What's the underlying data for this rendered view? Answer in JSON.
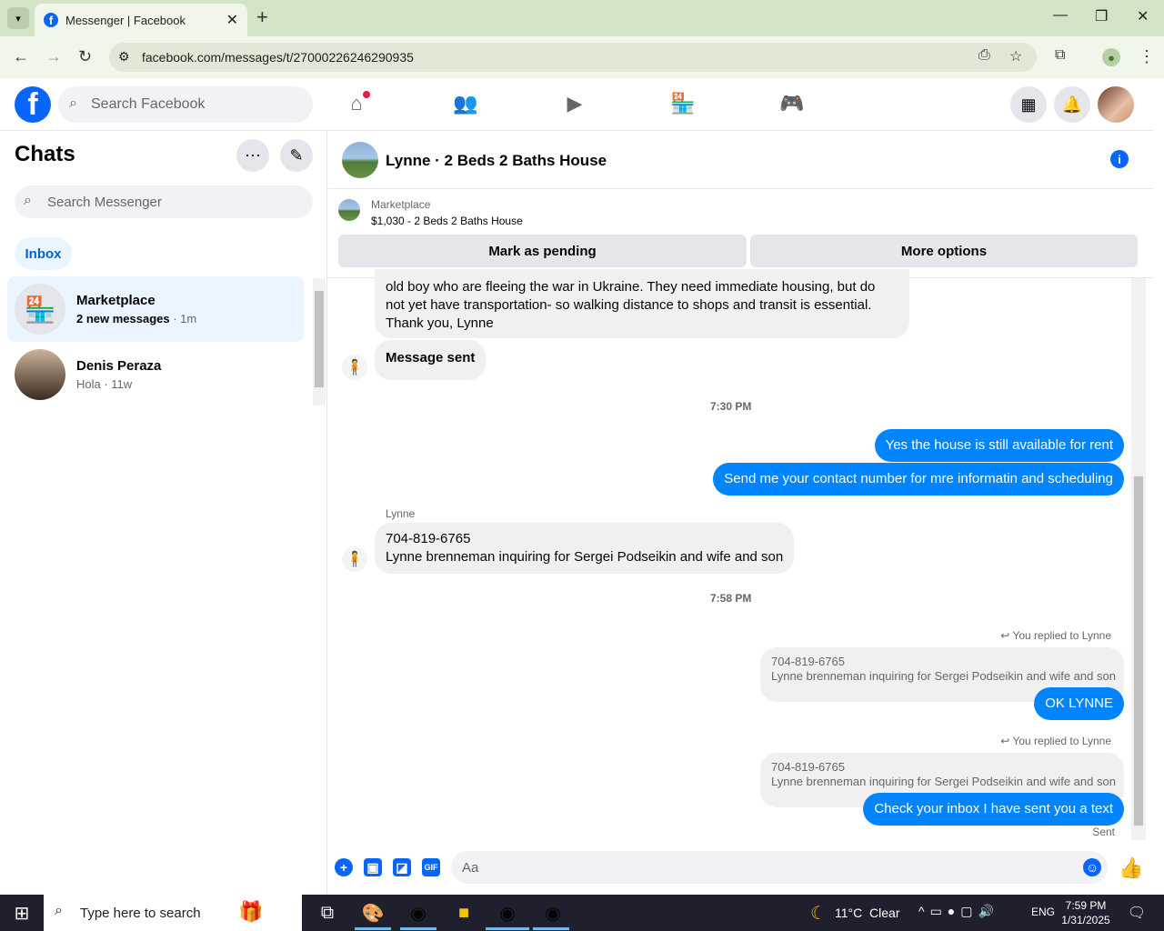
{
  "browser": {
    "tab_title": "Messenger | Facebook",
    "url": "facebook.com/messages/t/27000226246290935"
  },
  "fb": {
    "search_placeholder": "Search Facebook"
  },
  "sidebar": {
    "title": "Chats",
    "search_placeholder": "Search Messenger",
    "filter": "Inbox",
    "chats": [
      {
        "name": "Marketplace",
        "preview_bold": "2 new messages",
        "preview_time": " · 1m"
      },
      {
        "name": "Denis Peraza",
        "preview": "Hola · 11w"
      }
    ]
  },
  "chat": {
    "title": "Lynne · 2 Beds 2 Baths House",
    "marketplace_label": "Marketplace",
    "listing": "$1,030 - 2 Beds 2 Baths House",
    "mark_pending": "Mark as pending",
    "more_options": "More options"
  },
  "messages": {
    "m1_line1": "old boy who are fleeing the war in Ukraine. They need immediate housing, but do",
    "m1_line2": "not yet have transportation- so walking distance to shops and transit is essential.",
    "m1_line3": "Thank you, Lynne",
    "m2": "Message sent",
    "ts1": "7:30 PM",
    "out1": "Yes the house is still available for rent",
    "out2": "Send me your contact number for mre informatin and  scheduling",
    "sender": "Lynne",
    "in3_line1": "704-819-6765",
    "in3_line2": "Lynne brenneman inquiring for Sergei Podseikin and wife and son",
    "ts2": "7:58 PM",
    "replied1": "You replied to Lynne",
    "q1_line1": "704-819-6765",
    "q1_line2": "Lynne brenneman inquiring for Sergei Podseikin and wife and son",
    "out3": "OK LYNNE",
    "replied2": "You replied to Lynne",
    "q2_line1": "704-819-6765",
    "q2_line2": "Lynne brenneman inquiring for Sergei Podseikin and wife and son",
    "out4": "Check your inbox I have sent you a text",
    "status": "Sent"
  },
  "composer": {
    "placeholder": "Aa"
  },
  "taskbar": {
    "search_placeholder": "Type here to search",
    "weather": "11°C  Clear",
    "lang": "ENG",
    "time": "7:59 PM",
    "date": "1/31/2025"
  },
  "colors": {
    "fb_blue": "#0866ff",
    "messenger_blue": "#0084ff",
    "browser_green": "#d3e3c5"
  }
}
